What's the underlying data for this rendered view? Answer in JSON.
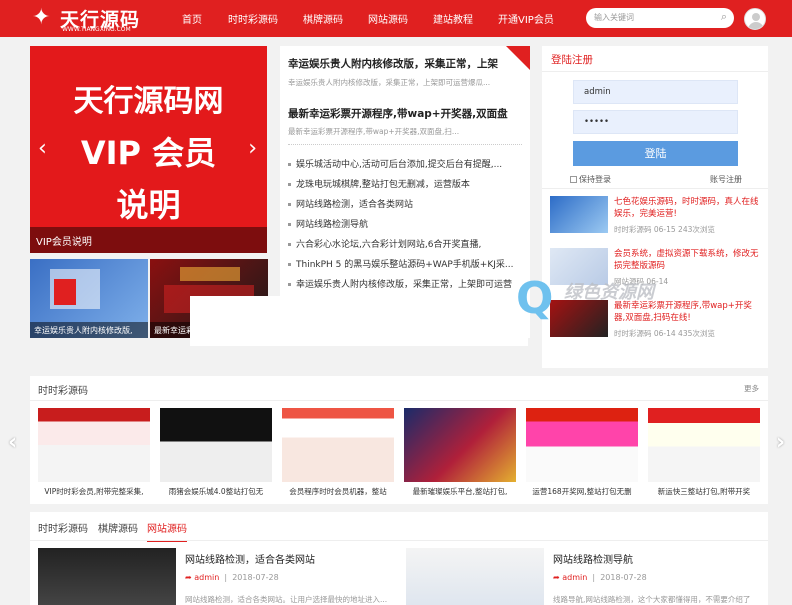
{
  "header": {
    "logo_text": "天行源码",
    "logo_url": "WWW.TIANGXING.COM",
    "nav": [
      "首页",
      "时时彩源码",
      "棋牌源码",
      "网站源码",
      "建站教程",
      "开通VIP会员"
    ],
    "search_placeholder": "输入关键词"
  },
  "banner": {
    "line1": "天行源码网",
    "line2": "VIP 会员",
    "line3": "说明",
    "caption": "VIP会员说明",
    "prev": "‹",
    "next": "›"
  },
  "thumbs": [
    {
      "caption": "幸运娱乐贵人附内核修改版,"
    },
    {
      "caption": "最新幸运彩票开..."
    }
  ],
  "articles": {
    "featured": [
      {
        "title": "幸运娱乐贵人附内核修改版，采集正常，上架",
        "desc": "幸运娱乐贵人附内核修改版，采集正常，上架即可运营爆瓜..."
      },
      {
        "title": "最新幸运彩票开源程序,带wap+开奖器,双面盘",
        "desc": "最新幸运彩票开源程序,带wap+开奖器,双面盘,扫..."
      }
    ],
    "list": [
      "娱乐城活动中心,活动可后台添加,提交后台有提醒,...",
      "龙珠电玩城棋牌,整站打包无删减，运营版本",
      "网站线路检测，适合各类网站",
      "网站线路检测导航",
      "六合彩心水论坛,六合彩计划网站,6合开奖直播,",
      "ThinkPH 5 的黑马娱乐整站源码+WAP手机版+KJ采...",
      "幸运娱乐贵人附内核修改版，采集正常，上架即可运营"
    ]
  },
  "login": {
    "title": "登陆注册",
    "username": "admin",
    "password": "•••••",
    "button": "登陆",
    "remember": "保持登录",
    "register": "账号注册",
    "items": [
      {
        "title": "七色花娱乐源码，时时源码，真人在线娱乐，完美运营!",
        "meta": "时时彩源码  06-15  243次浏览"
      },
      {
        "title": "会员系统，虚拟资源下载系统，修改无损完整版源码",
        "meta": "网站源码  06-14"
      },
      {
        "title": "最新幸运彩票开源程序,带wap+开奖器,双面盘,扫码在线!",
        "meta": "时时彩源码  06-14  435次浏览"
      }
    ]
  },
  "watermark": {
    "text": "绿色资源网"
  },
  "section2": {
    "title": "时时彩源码",
    "more": "更多",
    "cards": [
      "VIP时时彩会员,附带完整采集,",
      "雨猪会娱乐城4.0整站打包无",
      "会员程序时时会员机器，整站",
      "最新璀璨娱乐平台,整站打包,",
      "运营168开奖网,整站打包无删",
      "新运快三整站打包,附带开奖"
    ]
  },
  "section3": {
    "tabs": [
      "时时彩源码",
      "棋牌源码",
      "网站源码"
    ],
    "posts": [
      {
        "title": "网站线路检测，适合各类网站",
        "author": "admin",
        "date": "2018-07-28",
        "desc": "网站线路检测，适合各类网站。让用户选择最快的地址进入..."
      },
      {
        "title": "网站线路检测导航",
        "author": "admin",
        "date": "2018-07-28",
        "desc": "线路导航,网站线路检测，这个大家都懂得用，不需要介绍了"
      }
    ]
  },
  "colors": {
    "brand": "#e02020",
    "login_button": "#5b9be0",
    "input_bg": "#e9f0fd"
  }
}
